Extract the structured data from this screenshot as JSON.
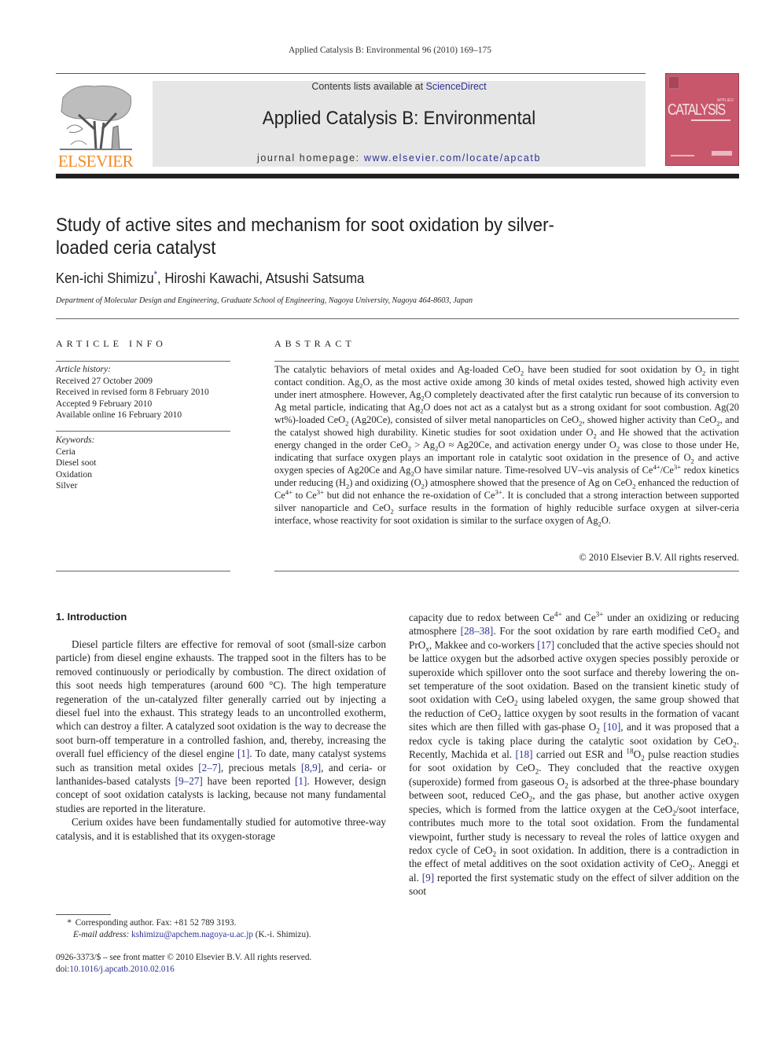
{
  "running_head": "Applied Catalysis B: Environmental 96 (2010) 169–175",
  "masthead": {
    "publisher_logo_text": "ELSEVIER",
    "contents_prefix": "Contents lists available at ",
    "contents_link": "ScienceDirect",
    "journal_name": "Applied Catalysis B: Environmental",
    "homepage_prefix": "journal homepage: ",
    "homepage_link": "www.elsevier.com/locate/apcatb",
    "cover_title": "CATALYSIS",
    "cover_applied": "APPLIED",
    "cover_color": "#c9576c",
    "logo_color": "#f08a24",
    "link_color": "#2e3192"
  },
  "article": {
    "title": "Study of active sites and mechanism for soot oxidation by silver-loaded ceria catalyst",
    "authors": [
      {
        "name": "Ken-ichi Shimizu",
        "mark": "*"
      },
      {
        "name": "Hiroshi Kawachi",
        "mark": ""
      },
      {
        "name": "Atsushi Satsuma",
        "mark": ""
      }
    ],
    "authors_sep": ", ",
    "affiliation": "Department of Molecular Design and Engineering, Graduate School of Engineering, Nagoya University, Nagoya 464-8603, Japan"
  },
  "article_info": {
    "heading": "ARTICLE INFO",
    "history_label": "Article history:",
    "history": [
      "Received 27 October 2009",
      "Received in revised form 8 February 2010",
      "Accepted 9 February 2010",
      "Available online 16 February 2010"
    ],
    "keywords_label": "Keywords:",
    "keywords": [
      "Ceria",
      "Diesel soot",
      "Oxidation",
      "Silver"
    ]
  },
  "abstract": {
    "heading": "ABSTRACT",
    "html": "The catalytic behaviors of metal oxides and Ag-loaded CeO<sub>2</sub> have been studied for soot oxidation by O<sub>2</sub> in tight contact condition. Ag<sub>2</sub>O, as the most active oxide among 30 kinds of metal oxides tested, showed high activity even under inert atmosphere. However, Ag<sub>2</sub>O completely deactivated after the first catalytic run because of its conversion to Ag metal particle, indicating that Ag<sub>2</sub>O does not act as a catalyst but as a strong oxidant for soot combustion. Ag(20 wt%)-loaded CeO<sub>2</sub> (Ag20Ce), consisted of silver metal nanoparticles on CeO<sub>2</sub>, showed higher activity than CeO<sub>2</sub>, and the catalyst showed high durability. Kinetic studies for soot oxidation under O<sub>2</sub> and He showed that the activation energy changed in the order CeO<sub>2</sub> &gt; Ag<sub>2</sub>O ≈ Ag20Ce, and activation energy under O<sub>2</sub> was close to those under He, indicating that surface oxygen plays an important role in catalytic soot oxidation in the presence of O<sub>2</sub> and active oxygen species of Ag20Ce and Ag<sub>2</sub>O have similar nature. Time-resolved UV–vis analysis of Ce<sup>4+</sup>/Ce<sup>3+</sup> redox kinetics under reducing (H<sub>2</sub>) and oxidizing (O<sub>2</sub>) atmosphere showed that the presence of Ag on CeO<sub>2</sub> enhanced the reduction of Ce<sup>4+</sup> to Ce<sup>3+</sup> but did not enhance the re-oxidation of Ce<sup>3+</sup>. It is concluded that a strong interaction between supported silver nanoparticle and CeO<sub>2</sub> surface results in the formation of highly reducible surface oxygen at silver-ceria interface, whose reactivity for soot oxidation is similar to the surface oxygen of Ag<sub>2</sub>O.",
    "copyright": "© 2010 Elsevier B.V. All rights reserved."
  },
  "introduction": {
    "heading": "1.  Introduction",
    "col1_paragraphs": [
      "Diesel particle filters are effective for removal of soot (small-size carbon particle) from diesel engine exhausts. The trapped soot in the filters has to be removed continuously or periodically by combustion. The direct oxidation of this soot needs high temperatures (around 600 °C). The high temperature regeneration of the un-catalyzed filter generally carried out by injecting a diesel fuel into the exhaust. This strategy leads to an uncontrolled exotherm, which can destroy a filter. A catalyzed soot oxidation is the way to decrease the soot burn-off temperature in a controlled fashion, and, thereby, increasing the overall fuel efficiency of the diesel engine <span class=\"link\">[1]</span>. To date, many catalyst systems such as transition metal oxides <span class=\"link\">[2–7]</span>, precious metals <span class=\"link\">[8,9]</span>, and ceria- or lanthanides-based catalysts <span class=\"link\">[9–27]</span> have been reported <span class=\"link\">[1]</span>. However, design concept of soot oxidation catalysts is lacking, because not many fundamental studies are reported in the literature.",
      "Cerium oxides have been fundamentally studied for automotive three-way catalysis, and it is established that its oxygen-storage"
    ],
    "col2_html": "capacity due to redox between Ce<sup>4+</sup> and Ce<sup>3+</sup> under an oxidizing or reducing atmosphere <span class=\"link\">[28–38]</span>. For the soot oxidation by rare earth modified CeO<sub>2</sub> and PrO<sub>x</sub>, Makkee and co-workers <span class=\"link\">[17]</span> concluded that the active species should not be lattice oxygen but the adsorbed active oxygen species possibly peroxide or superoxide which spillover onto the soot surface and thereby lowering the on-set temperature of the soot oxidation. Based on the transient kinetic study of soot oxidation with CeO<sub>2</sub> using labeled oxygen, the same group showed that the reduction of CeO<sub>2</sub> lattice oxygen by soot results in the formation of vacant sites which are then filled with gas-phase O<sub>2</sub> <span class=\"link\">[10]</span>, and it was proposed that a redox cycle is taking place during the catalytic soot oxidation by CeO<sub>2</sub>. Recently, Machida et al. <span class=\"link\">[18]</span> carried out ESR and <sup>18</sup>O<sub>2</sub> pulse reaction studies for soot oxidation by CeO<sub>2</sub>. They concluded that the reactive oxygen (superoxide) formed from gaseous O<sub>2</sub> is adsorbed at the three-phase boundary between soot, reduced CeO<sub>2</sub>, and the gas phase, but another active oxygen species, which is formed from the lattice oxygen at the CeO<sub>2</sub>/soot interface, contributes much more to the total soot oxidation. From the fundamental viewpoint, further study is necessary to reveal the roles of lattice oxygen and redox cycle of CeO<sub>2</sub> in soot oxidation. In addition, there is a contradiction in the effect of metal additives on the soot oxidation activity of CeO<sub>2</sub>. Aneggi et al. <span class=\"link\">[9]</span> reported the first systematic study on the effect of silver addition on the soot"
  },
  "footnote": {
    "star": "*",
    "corresponding": "Corresponding author. Fax: +81 52 789 3193.",
    "email_label": "E-mail address:",
    "email": "kshimizu@apchem.nagoya-u.ac.jp",
    "email_suffix": " (K.-i. Shimizu)."
  },
  "front_matter": {
    "issn_line": "0926-3373/$ – see front matter © 2010 Elsevier B.V. All rights reserved.",
    "doi_prefix": "doi:",
    "doi": "10.1016/j.apcatb.2010.02.016"
  }
}
